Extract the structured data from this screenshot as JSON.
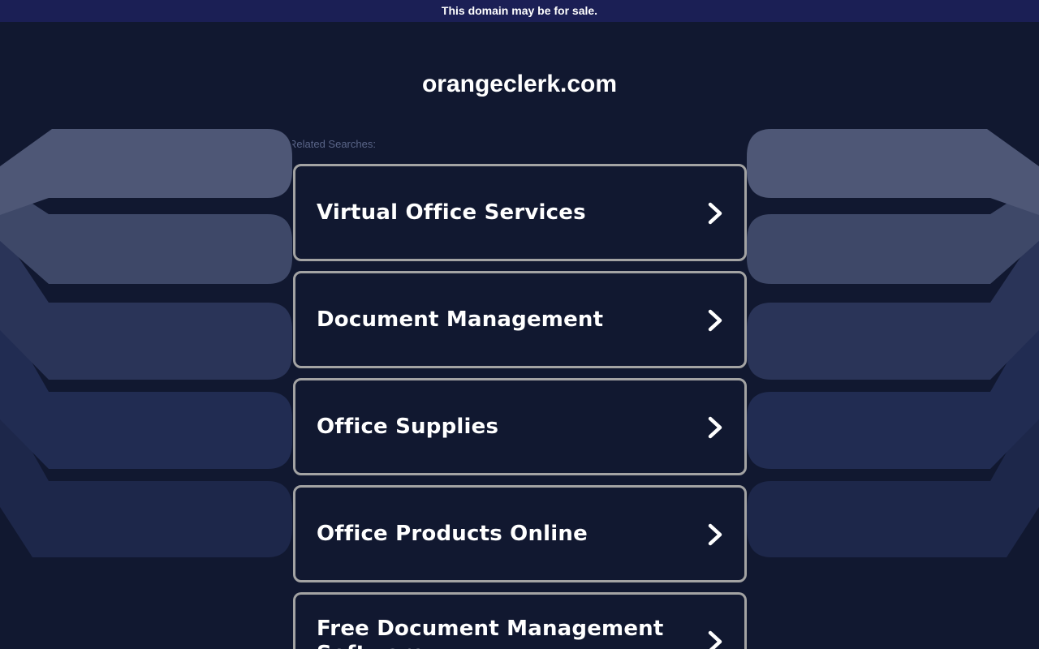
{
  "banner": {
    "text": "This domain may be for sale."
  },
  "site": {
    "domain": "orangeclerk.com"
  },
  "related": {
    "label": "Related Searches:",
    "items": [
      {
        "label": "Virtual Office Services"
      },
      {
        "label": "Document Management"
      },
      {
        "label": "Office Supplies"
      },
      {
        "label": "Office Products Online"
      },
      {
        "label": "Free Document Management Software"
      }
    ]
  },
  "colors": {
    "background": "#111830",
    "banner": "#1b1f55",
    "tile_border": "#a3a3a3",
    "text": "#ffffff"
  }
}
